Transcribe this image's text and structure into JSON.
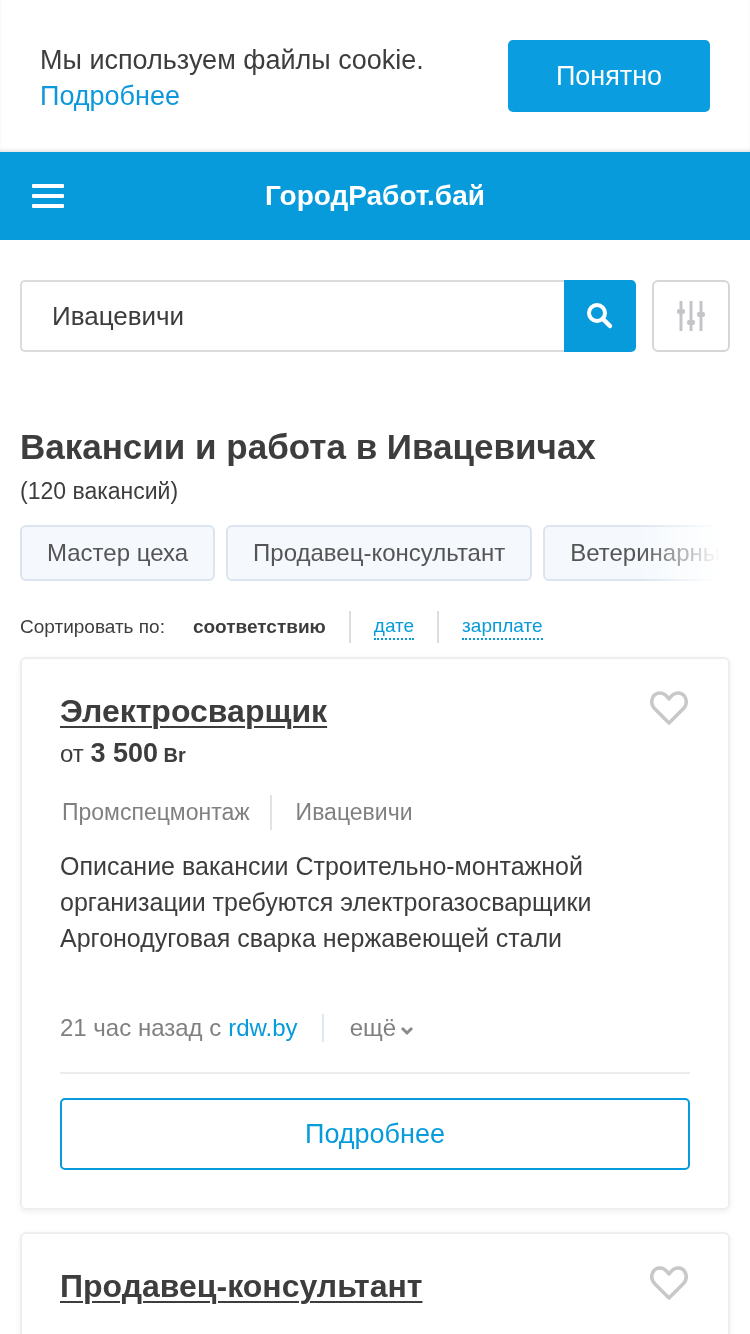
{
  "cookie_bar": {
    "text": "Мы используем файлы cookie.",
    "link": "Подробнее",
    "button": "Понятно"
  },
  "header": {
    "logo": "ГородРабот.бай"
  },
  "search": {
    "value": "Ивацевичи"
  },
  "heading": "Вакансии и работа в Ивацевичах",
  "count": "(120 вакансий)",
  "chips": [
    "Мастер цеха",
    "Продавец-консультант",
    "Ветеринарны"
  ],
  "sort": {
    "label": "Сортировать по:",
    "options": [
      {
        "label": "соответствию",
        "selected": true
      },
      {
        "label": "дате",
        "selected": false
      },
      {
        "label": "зарплате",
        "selected": false
      }
    ]
  },
  "vacancies": [
    {
      "title": "Электросварщик",
      "salary_prefix": "от",
      "salary": "3 500",
      "currency": "Br",
      "company": "Промспецмонтаж",
      "city": "Ивацевичи",
      "description": "Описание вакансии Строительно-монтажной организации требуются электрогазосварщики Аргонодуговая сварка нержавеющей стали",
      "posted": "21 час назад с",
      "source": "rdw.by",
      "more": "ещё",
      "button": "Подробнее",
      "favorite": false
    },
    {
      "title": "Продавец-консультант",
      "favorite": false
    }
  ]
}
